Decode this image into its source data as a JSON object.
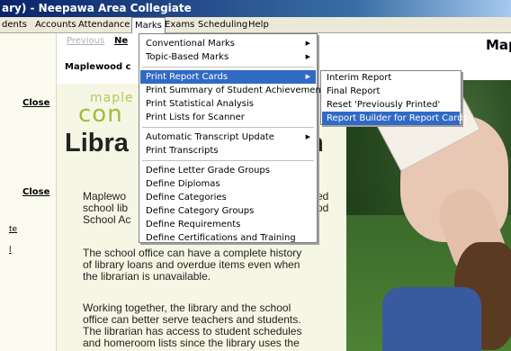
{
  "window": {
    "title": "ary) - Neepawa Area Collegiate"
  },
  "menubar": {
    "items": [
      {
        "label": "dents"
      },
      {
        "label": "Accounts"
      },
      {
        "label": "Attendance"
      },
      {
        "label": "Marks"
      },
      {
        "label": "Exams"
      },
      {
        "label": "Scheduling"
      },
      {
        "label": "Help"
      }
    ]
  },
  "sidebar": {
    "close1": "Close",
    "close2": "Close",
    "link1": "te",
    "link2": "l"
  },
  "doc": {
    "prev": "Previous",
    "next": "Ne",
    "school": "Maplewood c",
    "right_heading": "Map",
    "brand_small": "maple",
    "brand_big": "con",
    "title_left": "Libra",
    "title_right": "n",
    "para1": [
      "Maplewo",
      "school lib",
      "School Ac"
    ],
    "para1_right": [
      "ed",
      "od",
      ""
    ],
    "para2": [
      "The school office can have a complete history",
      "of library loans and overdue items even when",
      "the librarian is unavailable."
    ],
    "para3": [
      "Working together, the library and the school",
      "office can better serve teachers and students.",
      "The librarian has access to student schedules",
      "and homeroom lists since the library uses the"
    ]
  },
  "marks_menu": {
    "items": [
      {
        "label": "Conventional Marks",
        "arrow": "▶"
      },
      {
        "label": "Topic-Based Marks",
        "arrow": "▶"
      },
      {
        "label": "Print Report Cards",
        "arrow": "▶"
      },
      {
        "label": "Print Summary of Student Achievements",
        "arrow": ""
      },
      {
        "label": "Print Statistical Analysis",
        "arrow": ""
      },
      {
        "label": "Print Lists for Scanner",
        "arrow": ""
      },
      {
        "label": "Automatic Transcript Update",
        "arrow": "▶"
      },
      {
        "label": "Print Transcripts",
        "arrow": ""
      },
      {
        "label": "Define Letter Grade Groups",
        "arrow": ""
      },
      {
        "label": "Define Diplomas",
        "arrow": ""
      },
      {
        "label": "Define Categories",
        "arrow": ""
      },
      {
        "label": "Define Category Groups",
        "arrow": ""
      },
      {
        "label": "Define Requirements",
        "arrow": ""
      },
      {
        "label": "Define Certifications and Training",
        "arrow": ""
      }
    ]
  },
  "report_submenu": {
    "items": [
      {
        "label": "Interim Report"
      },
      {
        "label": "Final Report"
      },
      {
        "label": "Reset 'Previously Printed'"
      },
      {
        "label": "Report Builder for Report Cards"
      }
    ]
  }
}
